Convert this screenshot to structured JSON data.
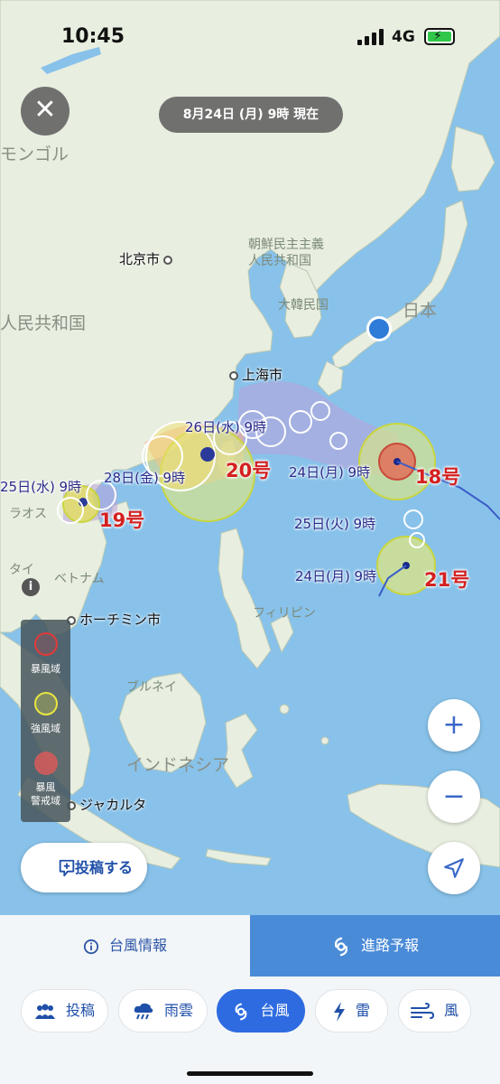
{
  "status_bar": {
    "time": "10:45",
    "network": "4G"
  },
  "header": {
    "date_label": "8月24日 (月) 9時 現在"
  },
  "map_labels": {
    "mongolia": "モンゴル",
    "china": "人民共和国",
    "north_korea": "朝鮮民主主義\n人民共和国",
    "south_korea": "大韓民国",
    "japan": "日本",
    "vietnam_left": "タイ",
    "vietnam": "ベトナム",
    "philippines": "フィリピン",
    "brunei": "ブルネイ",
    "indonesia": "インドネシア",
    "laos": "ラオス",
    "beijing": "北京市",
    "shanghai": "上海市",
    "hochiminh": "ホーチミン市",
    "jakarta": "ジャカルタ"
  },
  "typhoons": {
    "t18": {
      "name": "18号",
      "time": "24日(月) 9時"
    },
    "t19": {
      "name": "19号",
      "time": "25日(水) 9時"
    },
    "t20": {
      "name": "20号",
      "time_a": "26日(水) 9時",
      "time_b": "28日(金) 9時"
    },
    "t21": {
      "name": "21号",
      "time_a": "25日(火) 9時",
      "time_b": "24日(月) 9時"
    }
  },
  "legend": {
    "storm": "暴風域",
    "strong_wind": "強風域",
    "storm_warning": "暴風\n警戒域",
    "colors": {
      "storm": "#e03a3a",
      "strong_wind": "#e8e640",
      "warning": "#d85a5a"
    }
  },
  "controls": {
    "zoom_in": "+",
    "zoom_out": "−",
    "post": "投稿する"
  },
  "tabs": {
    "info": "台風情報",
    "forecast": "進路予報"
  },
  "bottom_nav": {
    "post": "投稿",
    "rain": "雨雲",
    "typhoon": "台風",
    "thunder": "雷",
    "wind": "風"
  },
  "colors": {
    "accent": "#2e6be0",
    "sea": "#88c2ea",
    "land": "#e8eee0"
  }
}
